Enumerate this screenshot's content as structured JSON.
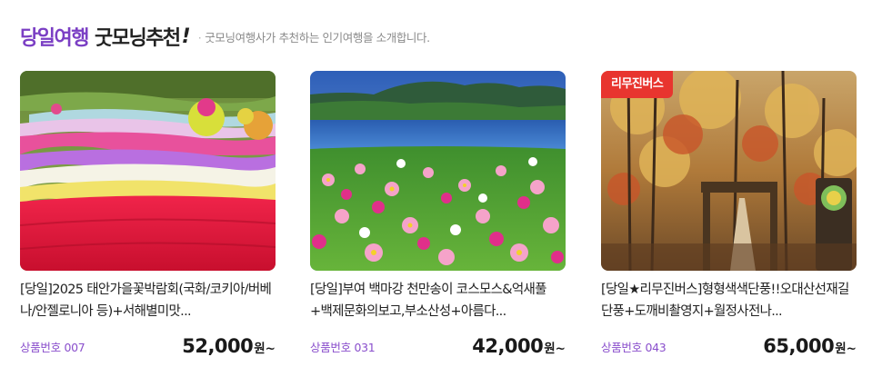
{
  "header": {
    "title_accent": "당일여행",
    "title_main": "굿모닝추천",
    "title_bang": "!",
    "subtitle_dot": "·",
    "subtitle": "굿모닝여행사가 추천하는 인기여행을 소개합니다."
  },
  "cards": [
    {
      "name": "[당일]2025 태안가을꽃박람회(국화/코키아/버베나/안젤로니아 등)+서해별미맛...",
      "code": "상품번호 007",
      "price": "52,000",
      "won": "원~",
      "image": "red-salvia-flower-garden-photo"
    },
    {
      "name": "[당일]부여 백마강 천만송이 코스모스&억새풀+백제문화의보고,부소산성+아름다...",
      "code": "상품번호 031",
      "price": "42,000",
      "won": "원~",
      "image": "cosmos-field-lake-photo"
    },
    {
      "badge": "리무진버스",
      "name": "[당일★리무진버스]형형색색단풍!!오대산선재길단풍+도깨비촬영지+월정사전나...",
      "code": "상품번호 043",
      "price": "65,000",
      "won": "원~",
      "image": "autumn-forest-trail-photo"
    }
  ],
  "colors": {
    "accent_purple": "#7b3fc4",
    "code_purple": "#8a4fcc",
    "badge_red": "#e8352f",
    "subtitle_gray": "#8a8a8a"
  }
}
